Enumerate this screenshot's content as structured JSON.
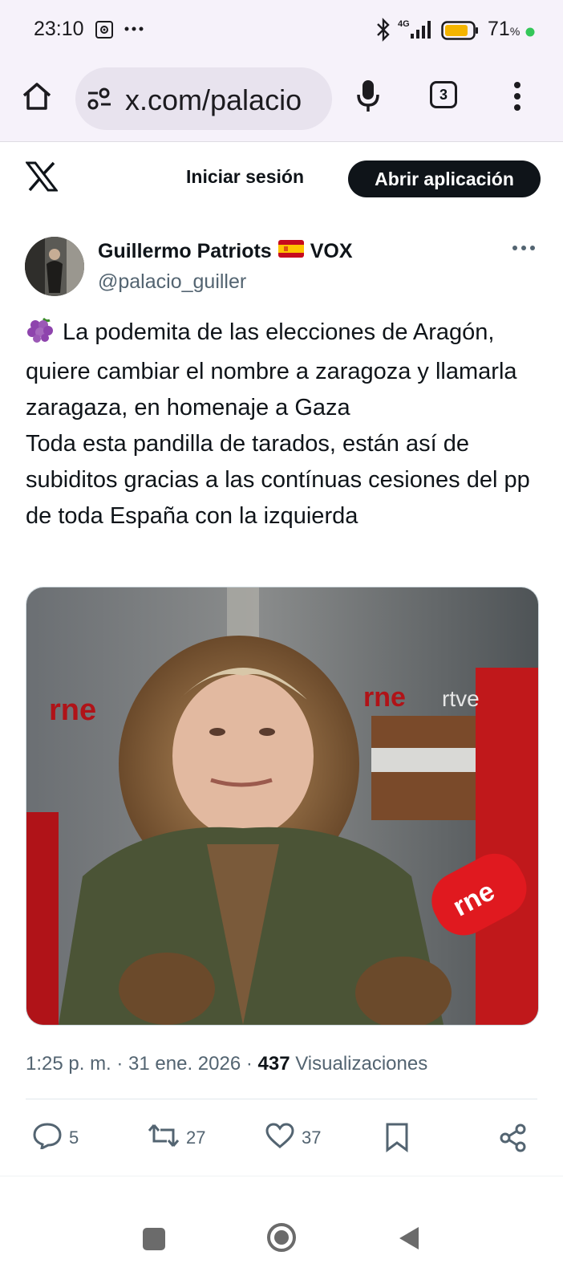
{
  "status_bar": {
    "time": "23:10",
    "network": "4G",
    "battery_percent": "71",
    "battery_unit": "%"
  },
  "browser": {
    "url": "x.com/palacio",
    "tab_count": "3"
  },
  "x_header": {
    "login_label": "Iniciar sesión",
    "open_app_label": "Abrir aplicación"
  },
  "tweet": {
    "author_name": "Guillermo Patriots",
    "author_suffix": "VOX",
    "handle": "@palacio_guiller",
    "text_line1": "La podemita de las elecciones de Aragón, quiere cambiar el nombre a zaragoza y llamarla zaragaza, en homenaje a Gaza",
    "text_line2": "Toda esta pandilla de tarados, están así de subiditos gracias a las contínuas cesiones del pp de toda España con la izquierda",
    "media_logos": {
      "rne_left": "rne",
      "rne_mid": "rne",
      "rtve": "rtve",
      "mic": "rne"
    },
    "timestamp": "1:25 p. m. · 31 ene. 2026 · ",
    "views_count": "437",
    "views_label": " Visualizaciones",
    "replies": "5",
    "reposts": "27",
    "likes": "37"
  },
  "colors": {
    "brand_black": "#0f1419",
    "muted": "#536471",
    "chrome_bg": "#f6f2fa"
  }
}
